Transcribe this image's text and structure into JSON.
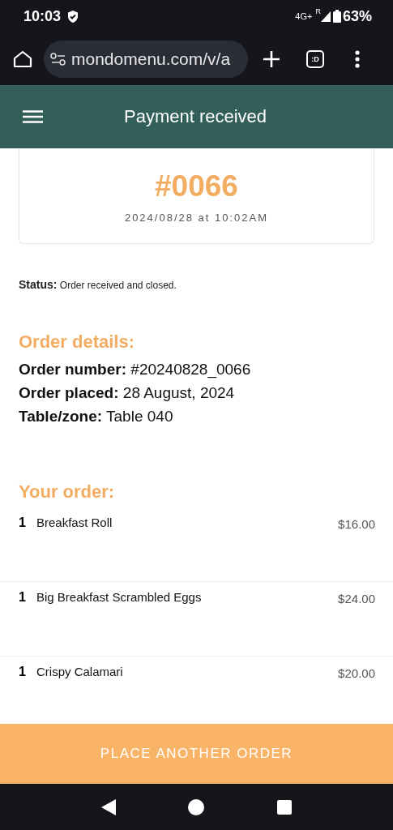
{
  "status_bar": {
    "time": "10:03",
    "network": "4G+",
    "roaming": "R",
    "battery": "63%"
  },
  "browser": {
    "url": "mondomenu.com/v/a",
    "tabs_label": ":D"
  },
  "header": {
    "title": "Payment received"
  },
  "order_card": {
    "number": "#0066",
    "datetime": "2024/08/28 at 10:02AM"
  },
  "status": {
    "label": "Status:",
    "value": "Order received and closed."
  },
  "order_details": {
    "heading": "Order details:",
    "fields": [
      {
        "label": "Order number:",
        "value": "#20240828_0066"
      },
      {
        "label": "Order placed:",
        "value": "28 August, 2024"
      },
      {
        "label": "Table/zone:",
        "value": "Table 040"
      }
    ]
  },
  "your_order": {
    "heading": "Your order:",
    "items": [
      {
        "qty": "1",
        "name": "Breakfast Roll",
        "price": "$16.00"
      },
      {
        "qty": "1",
        "name": "Big Breakfast Scrambled Eggs",
        "price": "$24.00"
      },
      {
        "qty": "1",
        "name": "Crispy Calamari",
        "price": "$20.00"
      }
    ]
  },
  "action_button": "PLACE ANOTHER ORDER"
}
